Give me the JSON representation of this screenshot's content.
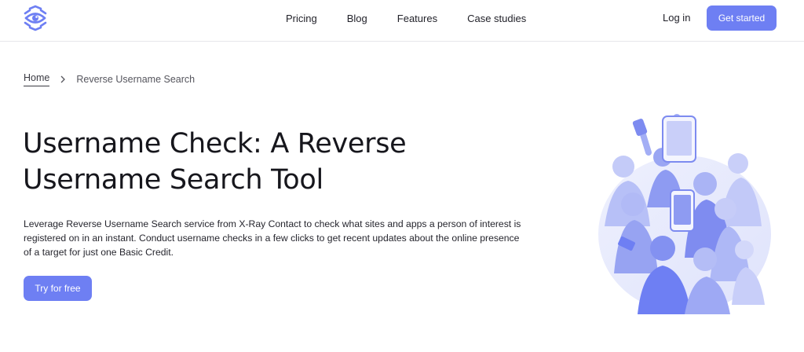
{
  "nav": {
    "links": [
      "Pricing",
      "Blog",
      "Features",
      "Case studies"
    ],
    "login": "Log in",
    "cta": "Get started"
  },
  "breadcrumb": {
    "home": "Home",
    "current": "Reverse Username Search"
  },
  "hero": {
    "title": "Username Check: A Reverse Username Search Tool",
    "description": "Leverage Reverse Username Search service from X-Ray Contact to check what sites and apps a person of interest is registered on in an instant. Conduct username checks in a few clicks to get recent updates about the online presence of a target for just one Basic Credit.",
    "cta": "Try for free"
  },
  "colors": {
    "accent": "#6e7ff3",
    "illustration_light": "#d9ddfb",
    "illustration_mid": "#a9b3f5",
    "illustration_dark": "#6e7ff3"
  },
  "icons": {
    "logo": "eye-logo-icon",
    "breadcrumb_separator": "chevron-right-icon"
  }
}
